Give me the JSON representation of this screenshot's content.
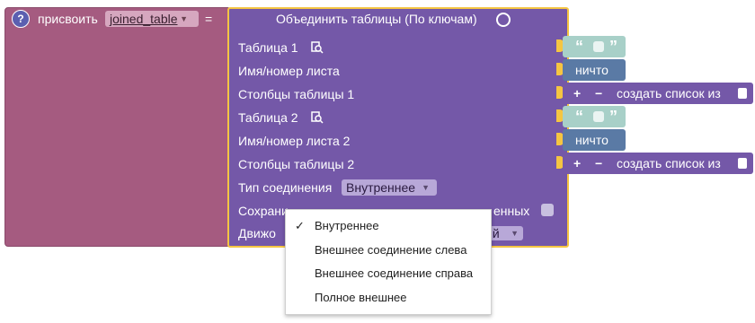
{
  "assign": {
    "help_glyph": "?",
    "label": "присвоить",
    "variable": "joined_table",
    "equals": "="
  },
  "join": {
    "title": "Объединить таблицы (По ключам)",
    "rows": {
      "table1": "Таблица 1",
      "sheet1": "Имя/номер листа",
      "cols1": "Столбцы таблицы 1",
      "table2": "Таблица 2",
      "sheet2": "Имя/номер листа 2",
      "cols2": "Столбцы таблицы 2",
      "join_type": "Тип соединения",
      "save_partial": "Сохрани",
      "save_partial_tail": "енных",
      "engine_partial": "Движо",
      "engine_tail": "ий"
    },
    "join_type_value": "Внутреннее"
  },
  "inputs": {
    "open_quote": "“",
    "close_quote": "”",
    "null_label": "ничто",
    "plus": "+",
    "minus": "−",
    "create_list": "создать список из"
  },
  "menu": {
    "checkmark": "✓",
    "items": [
      "Внутреннее",
      "Внешнее соединение слева",
      "Внешнее соединение справа",
      "Полное внешнее"
    ],
    "selected_index": 0
  },
  "icons": {
    "help": "help-icon",
    "chart": "chart-icon",
    "table_search": "table-search-icon",
    "dropdown": "chevron-down-icon"
  },
  "colors": {
    "assign_block": "#a55b80",
    "join_block": "#7458a8",
    "selection_outline": "#f5c542",
    "text_block": "#a8d0c8",
    "null_block": "#5a7aa5"
  }
}
